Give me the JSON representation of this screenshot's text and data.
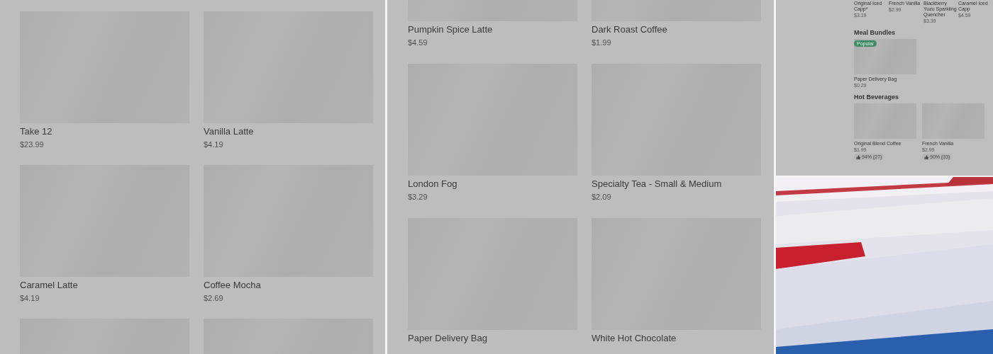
{
  "left_panel": {
    "items": [
      {
        "kind": "item",
        "name": "Take 12",
        "price": "$23.99"
      },
      {
        "kind": "item",
        "name": "Vanilla Latte",
        "price": "$4.19"
      },
      {
        "kind": "item",
        "name": "Caramel Latte",
        "price": "$4.19"
      },
      {
        "kind": "item",
        "name": "Coffee Mocha",
        "price": "$2.69"
      },
      {
        "kind": "placeholder"
      },
      {
        "kind": "placeholder"
      }
    ]
  },
  "middle_panel": {
    "items": [
      {
        "kind": "item",
        "name": "Pumpkin Spice Latte",
        "price": "$4.59"
      },
      {
        "kind": "item",
        "name": "Dark Roast Coffee",
        "price": "$1.99"
      },
      {
        "kind": "item",
        "name": "London Fog",
        "price": "$3.29"
      },
      {
        "kind": "item",
        "name": "Specialty Tea - Small & Medium",
        "price": "$2.09"
      },
      {
        "kind": "item",
        "name": "Paper Delivery Bag"
      },
      {
        "kind": "item",
        "name": "White Hot Chocolate"
      }
    ]
  },
  "right_panel": {
    "top_items": [
      {
        "name": "Original Iced Capp*",
        "price": "$3.19"
      },
      {
        "name": "French Vanilla",
        "price": "$2.99"
      },
      {
        "name": "Blackberry Yuzu Sparkling Quencher",
        "price": "$3.39"
      },
      {
        "name": "Caramel Iced Capp",
        "price": "$4.59"
      }
    ],
    "sections": [
      {
        "title": "Meal Bundles",
        "items": [
          {
            "name": "Paper Delivery Bag",
            "price": "$0.29",
            "badge": "Popular"
          }
        ]
      },
      {
        "title": "Hot Beverages",
        "items": [
          {
            "name": "Original Blend Coffee",
            "price": "$1.99",
            "rating": "94% (27)"
          },
          {
            "name": "French Vanilla",
            "price": "$2.99",
            "rating": "90% (33)"
          }
        ]
      }
    ]
  }
}
